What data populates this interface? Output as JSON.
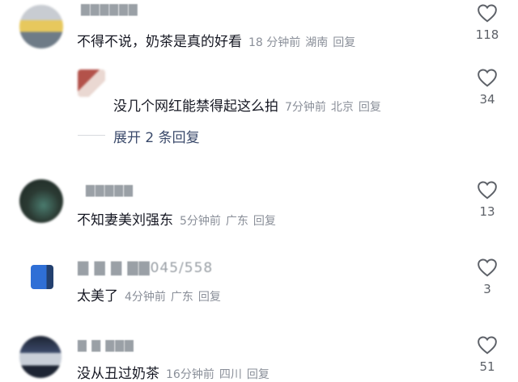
{
  "comments": [
    {
      "username": "▇▇▇▇▇▇",
      "text": "不得不说，奶茶是真的好看",
      "time": "18 分钟前",
      "location": "湖南",
      "reply_label": "回复",
      "likes": "118",
      "avatar_colors": [
        "#7f8a92",
        "#e6c65a",
        "#cfd6df"
      ]
    },
    {
      "username": "",
      "text": "没几个网红能禁得起这么拍",
      "time": "7分钟前",
      "location": "北京",
      "reply_label": "回复",
      "likes": "34",
      "avatar_colors": [
        "#b3524a",
        "#e8d6d0",
        "#ffffff"
      ]
    },
    {
      "username": "▇▇▇▇▇",
      "text": "不知妻美刘强东",
      "time": "5分钟前",
      "location": "广东",
      "reply_label": "回复",
      "likes": "13",
      "avatar_colors": [
        "#2b3a33",
        "#4a7b6e",
        "#1b2622"
      ]
    },
    {
      "username": "▇ ▇ ▇ ▇▇045/558",
      "text": "太美了",
      "time": "4分钟前",
      "location": "广东",
      "reply_label": "回复",
      "likes": "3",
      "avatar_colors": [
        "#2f6fd6",
        "#ffffff",
        "#23406f"
      ]
    },
    {
      "username": "▇ ▇ ▇▇▇",
      "text": "没从丑过奶茶",
      "time": "16分钟前",
      "location": "四川",
      "reply_label": "回复",
      "likes": "51",
      "avatar_colors": [
        "#3c4a6a",
        "#c9cfd8",
        "#1d2433"
      ]
    }
  ],
  "expand_replies": "展开 2 条回复"
}
